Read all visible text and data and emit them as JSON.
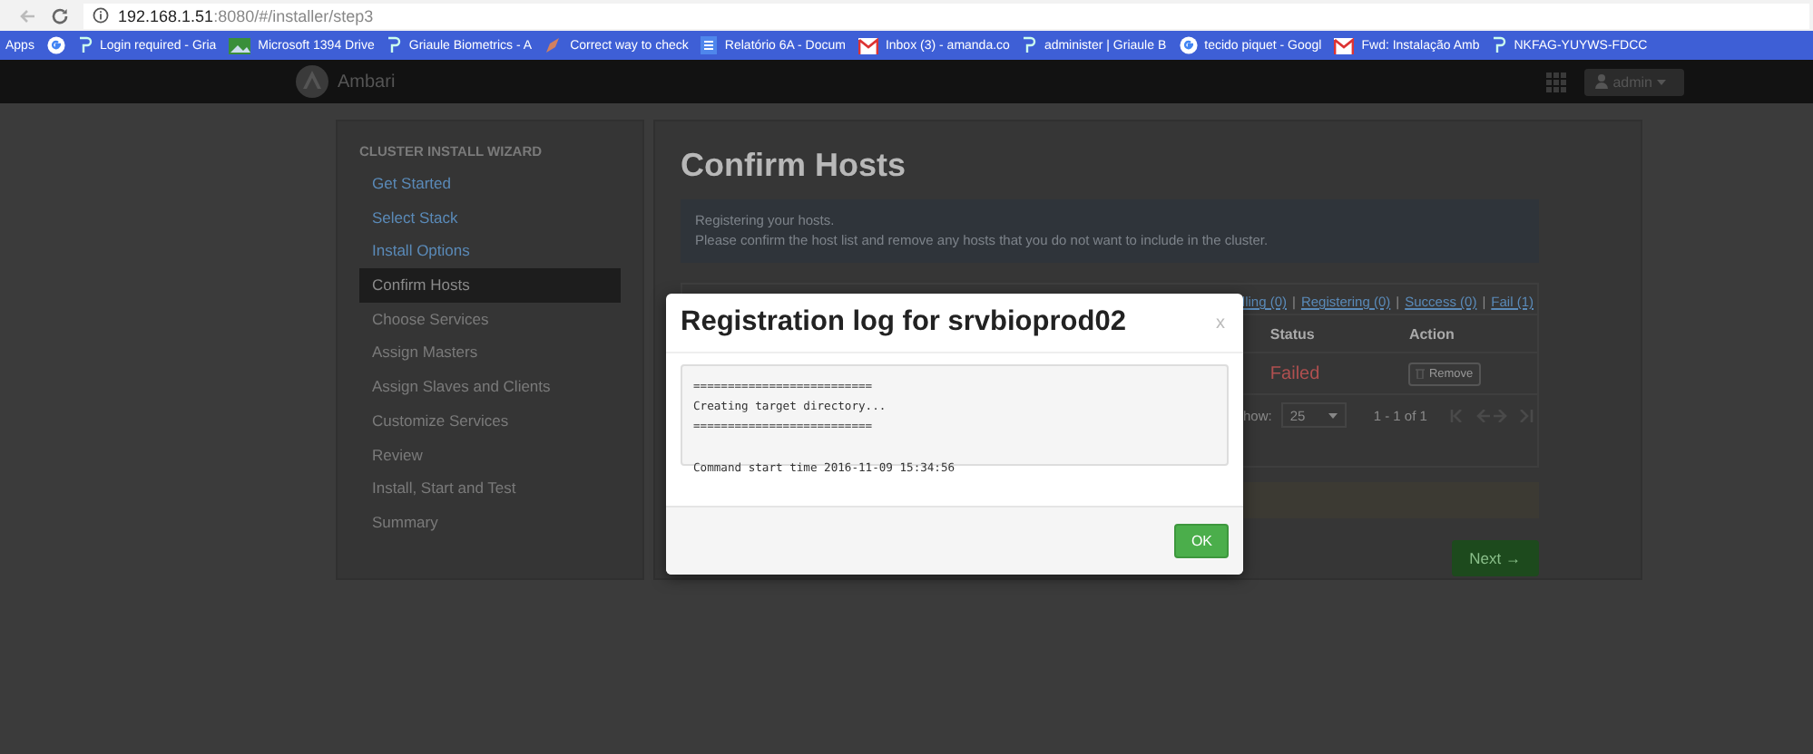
{
  "browser": {
    "url_host": "192.168.1.51",
    "url_path": ":8080/#/installer/step3",
    "bookmarks": [
      {
        "label": "Apps",
        "kind": "apps"
      },
      {
        "kind": "google"
      },
      {
        "label": "Login required - Gria",
        "kind": "site"
      },
      {
        "label": "Microsoft 1394 Drive",
        "kind": "image"
      },
      {
        "label": "Griaule Biometrics - A",
        "kind": "site"
      },
      {
        "label": "Correct way to check",
        "kind": "pen"
      },
      {
        "label": "Relatório 6A - Docum",
        "kind": "doc"
      },
      {
        "label": "Inbox (3) - amanda.co",
        "kind": "mail"
      },
      {
        "label": "administer | Griaule B",
        "kind": "site"
      },
      {
        "label": "tecido piquet - Googl",
        "kind": "google"
      },
      {
        "label": "Fwd: Instalação Amb",
        "kind": "mail"
      },
      {
        "label": "NKFAG-YUYWS-FDCC",
        "kind": "site"
      }
    ]
  },
  "navbar": {
    "brand": "Ambari",
    "user": "admin"
  },
  "sidebar": {
    "title": "CLUSTER INSTALL WIZARD",
    "items": [
      {
        "label": "Get Started",
        "done": true,
        "selected": false
      },
      {
        "label": "Select Stack",
        "done": true,
        "selected": false
      },
      {
        "label": "Install Options",
        "done": true,
        "selected": false
      },
      {
        "label": "Confirm Hosts",
        "done": false,
        "selected": true
      },
      {
        "label": "Choose Services",
        "done": false,
        "selected": false
      },
      {
        "label": "Assign Masters",
        "done": false,
        "selected": false
      },
      {
        "label": "Assign Slaves and Clients",
        "done": false,
        "selected": false
      },
      {
        "label": "Customize Services",
        "done": false,
        "selected": false
      },
      {
        "label": "Review",
        "done": false,
        "selected": false
      },
      {
        "label": "Install, Start and Test",
        "done": false,
        "selected": false
      },
      {
        "label": "Summary",
        "done": false,
        "selected": false
      }
    ]
  },
  "main": {
    "title": "Confirm Hosts",
    "alert": [
      "Registering your hosts.",
      "Please confirm the host list and remove any hosts that you do not want to include in the cluster."
    ],
    "filters": [
      {
        "kind": "link",
        "text": "lling (0)"
      },
      {
        "kind": "sep",
        "text": "|"
      },
      {
        "kind": "link",
        "text": "Registering (0)"
      },
      {
        "kind": "sep",
        "text": "|"
      },
      {
        "kind": "link",
        "text": "Success (0)"
      },
      {
        "kind": "sep",
        "text": "|"
      },
      {
        "kind": "link",
        "text": "Fail (1)"
      }
    ],
    "table": {
      "columns": [
        "Status",
        "Action"
      ],
      "rows": [
        {
          "status": "Failed",
          "action": "Remove"
        }
      ]
    },
    "pagination": {
      "show_label": "how:",
      "page_size": "25",
      "range": "1 - 1 of 1"
    },
    "next": "Next →"
  },
  "modal": {
    "title": "Registration log for srvbioprod02",
    "close": "x",
    "log": [
      "==========================",
      "Creating target directory...",
      "=========================="
    ],
    "log_start": "Command start time 2016-11-09 15:34:56",
    "ok": "OK"
  }
}
